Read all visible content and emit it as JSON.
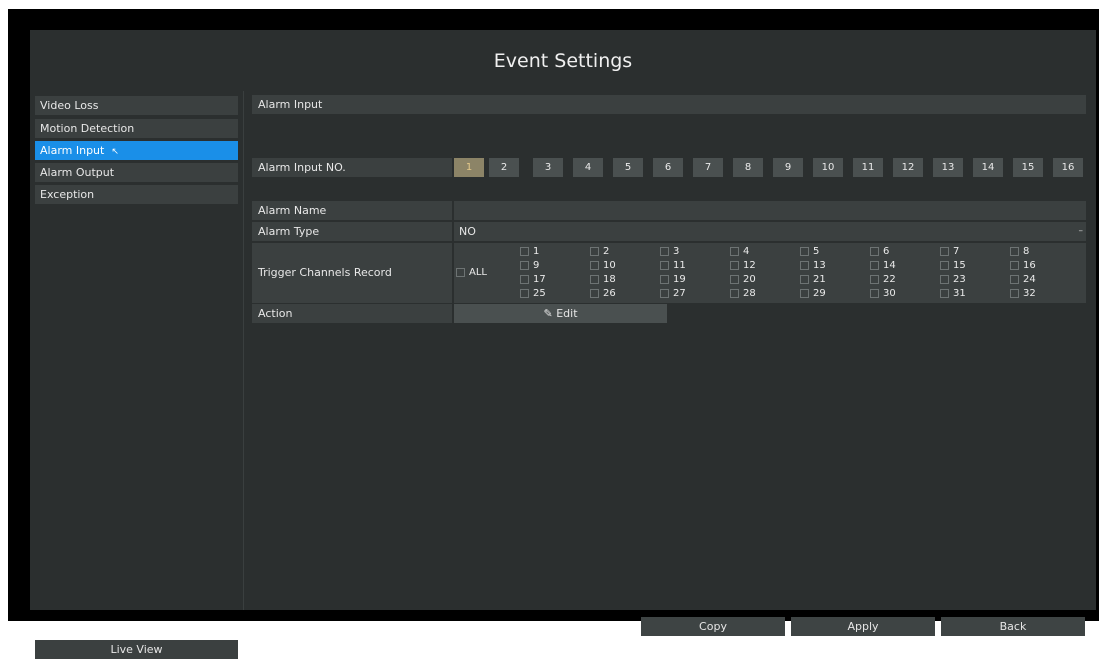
{
  "title": "Event Settings",
  "sidebar": {
    "items": [
      {
        "label": "Video Loss"
      },
      {
        "label": "Motion Detection"
      },
      {
        "label": "Alarm Input"
      },
      {
        "label": "Alarm Output"
      },
      {
        "label": "Exception"
      }
    ],
    "active_index": 2,
    "live_view_label": "Live View"
  },
  "main": {
    "section_header": "Alarm Input",
    "alarm_input_no_label": "Alarm Input NO.",
    "alarm_input_numbers": [
      "1",
      "2",
      "3",
      "4",
      "5",
      "6",
      "7",
      "8",
      "9",
      "10",
      "11",
      "12",
      "13",
      "14",
      "15",
      "16"
    ],
    "selected_input": "1",
    "alarm_name_label": "Alarm Name",
    "alarm_name_value": "",
    "alarm_type_label": "Alarm Type",
    "alarm_type_value": "NO",
    "trigger_label": "Trigger Channels Record",
    "all_label": "ALL",
    "channels": [
      "1",
      "2",
      "3",
      "4",
      "5",
      "6",
      "7",
      "8",
      "9",
      "10",
      "11",
      "12",
      "13",
      "14",
      "15",
      "16",
      "17",
      "18",
      "19",
      "20",
      "21",
      "22",
      "23",
      "24",
      "25",
      "26",
      "27",
      "28",
      "29",
      "30",
      "31",
      "32"
    ],
    "action_label": "Action",
    "edit_label": "Edit"
  },
  "buttons": {
    "copy": "Copy",
    "apply": "Apply",
    "back": "Back"
  },
  "colors": {
    "accent": "#1a8fe8",
    "selected_number": "#8c8467",
    "background": "#2b2f2f",
    "cell": "#3b4040"
  }
}
